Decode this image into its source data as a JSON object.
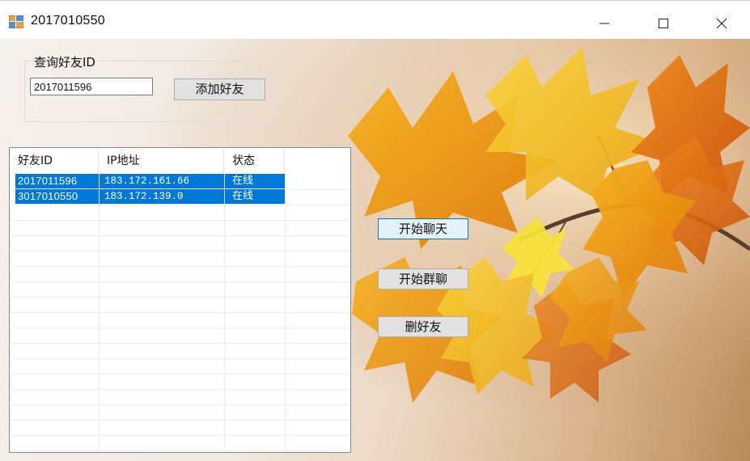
{
  "window": {
    "title": "2017010550",
    "controls": {
      "minimize": "minimize-icon",
      "maximize": "maximize-icon",
      "close": "close-icon"
    }
  },
  "query_group": {
    "legend": "查询好友ID",
    "input_value": "2017011596",
    "add_button": "添加好友"
  },
  "friends_list": {
    "columns": [
      "好友ID",
      "IP地址",
      "状态"
    ],
    "rows": [
      {
        "id": "2017011596",
        "ip": "183.172.161.66",
        "status": "在线"
      },
      {
        "id": "3017010550",
        "ip": "183.172.139.0",
        "status": "在线"
      }
    ],
    "selection_color": "#0078d7"
  },
  "actions": {
    "start_chat": "开始聊天",
    "start_group_chat": "开始群聊",
    "delete_friend": "删好友"
  },
  "colors": {
    "accent": "#0078d7",
    "button_face": "#e1e1e1",
    "leaf_orange": "#e8950f",
    "leaf_yellow": "#f3c21f"
  }
}
